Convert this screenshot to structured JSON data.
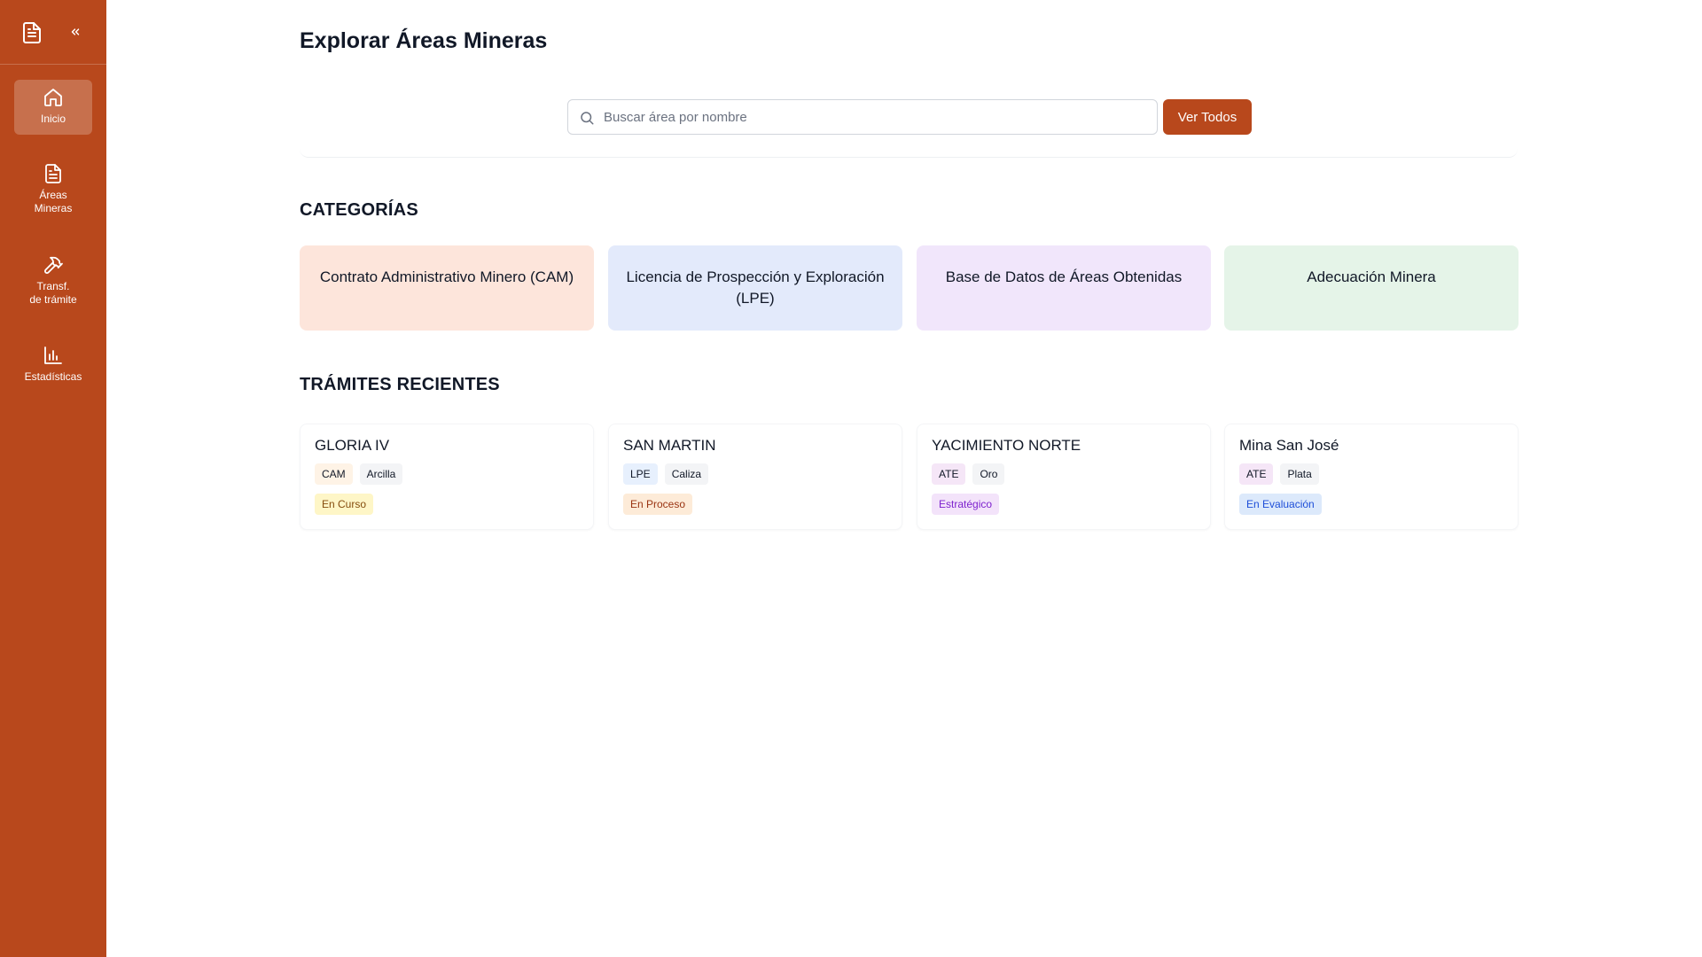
{
  "sidebar": {
    "items": [
      {
        "label": "Inicio",
        "icon": "home-icon",
        "active": true
      },
      {
        "label": "Áreas\nMineras",
        "icon": "document-icon",
        "active": false
      },
      {
        "label": "Transf.\nde trámite",
        "icon": "hammer-icon",
        "active": false
      },
      {
        "label": "Estadísticas",
        "icon": "bar-chart-icon",
        "active": false
      }
    ]
  },
  "page": {
    "title": "Explorar Áreas Mineras"
  },
  "search": {
    "placeholder": "Buscar área por nombre",
    "value": "",
    "button_label": "Ver Todos"
  },
  "categories": {
    "title": "CATEGORÍAS",
    "items": [
      {
        "label": "Contrato Administrativo Minero (CAM)",
        "bg": "#FDE5DB"
      },
      {
        "label": "Licencia de Prospección y Exploración (LPE)",
        "bg": "#E3EAFB"
      },
      {
        "label": "Base de Datos de Áreas Obtenidas",
        "bg": "#F1E6FB"
      },
      {
        "label": "Adecuación Minera",
        "bg": "#E5F4E8"
      }
    ]
  },
  "recent": {
    "title": "TRÁMITES RECIENTES",
    "items": [
      {
        "name": "GLORIA IV",
        "type": "CAM",
        "mineral": "Arcilla",
        "status": "En Curso",
        "type_bg": "#FEF3E6",
        "type_color": "#7c2d12",
        "status_bg": "#FEF6C7",
        "status_color": "#854d0e"
      },
      {
        "name": "SAN MARTIN",
        "type": "LPE",
        "mineral": "Caliza",
        "status": "En Proceso",
        "type_bg": "#E7F0FD",
        "type_color": "#1e3a8a",
        "status_bg": "#FDEBD8",
        "status_color": "#9a3412"
      },
      {
        "name": "YACIMIENTO NORTE",
        "type": "ATE",
        "mineral": "Oro",
        "status": "Estratégico",
        "type_bg": "#F5E6F7",
        "type_color": "#6b21a8",
        "status_bg": "#F3E3FA",
        "status_color": "#7e22ce"
      },
      {
        "name": "Mina San José",
        "type": "ATE",
        "mineral": "Plata",
        "status": "En Evaluación",
        "type_bg": "#F5E6F7",
        "type_color": "#6b21a8",
        "status_bg": "#DCE9FB",
        "status_color": "#1d4ed8"
      }
    ]
  },
  "colors": {
    "accent": "#B8481C",
    "mineral_tag_bg": "#F3F4F6"
  }
}
